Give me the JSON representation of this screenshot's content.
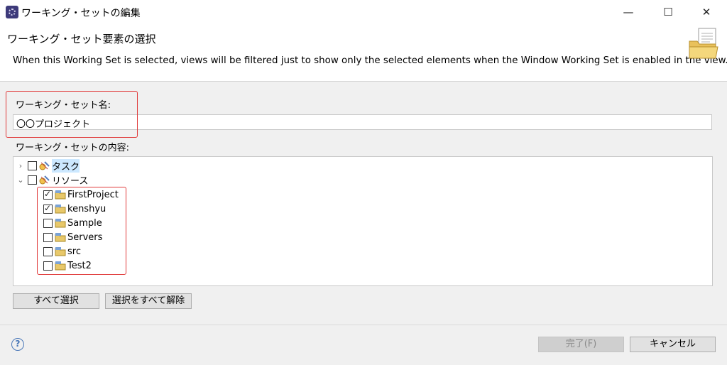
{
  "window": {
    "title": "ワーキング・セットの編集"
  },
  "header": {
    "title": "ワーキング・セット要素の選択",
    "description": "When this Working Set is selected, views will be filtered just to show only the selected elements when the Window Working Set is enabled in the view."
  },
  "form": {
    "name_label": "ワーキング・セット名:",
    "name_value": "〇〇プロジェクト",
    "content_label": "ワーキング・セットの内容:"
  },
  "tree": {
    "groups": [
      {
        "label": "タスク",
        "expanded": false,
        "checked": false
      },
      {
        "label": "リソース",
        "expanded": true,
        "checked": false
      }
    ],
    "projects": [
      {
        "label": "FirstProject",
        "checked": true
      },
      {
        "label": "kenshyu",
        "checked": true
      },
      {
        "label": "Sample",
        "checked": false
      },
      {
        "label": "Servers",
        "checked": false
      },
      {
        "label": "src",
        "checked": false
      },
      {
        "label": "Test2",
        "checked": false
      }
    ]
  },
  "buttons": {
    "select_all": "すべて選択",
    "deselect_all": "選択をすべて解除",
    "finish": "完了(F)",
    "cancel": "キャンセル"
  },
  "colors": {
    "highlight": "#e03a3a",
    "selection": "#cce8ff"
  }
}
